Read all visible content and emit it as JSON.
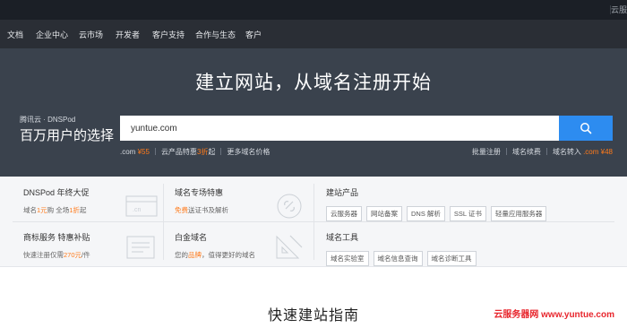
{
  "topbar": {
    "cloud_link": "云服"
  },
  "nav": {
    "items": [
      "文档",
      "企业中心",
      "云市场",
      "开发者",
      "客户支持",
      "合作与生态",
      "客户"
    ]
  },
  "hero": {
    "headline": "建立网站，从域名注册开始",
    "brand_small": "腾讯云 · DNSPod",
    "brand_big": "百万用户的选择",
    "search_value": "yuntue.com",
    "promo_left": {
      "com_label": ".com",
      "com_price": "¥55",
      "cloud_label": "云产品特惠",
      "cloud_discount": "3折",
      "cloud_suffix": "起",
      "more": "更多域名价格"
    },
    "promo_right": {
      "bulk": "批量注册",
      "renew": "域名续费",
      "transfer": "域名转入",
      "transfer_com": ".com",
      "transfer_price": "¥48"
    }
  },
  "offers": {
    "c1": {
      "title": "DNSPod 年终大促",
      "sub_a": "域名",
      "sub_b": "1元",
      "sub_c": "购 全场",
      "sub_d": "1折",
      "sub_e": "起"
    },
    "c2": {
      "title": "域名专场特惠",
      "sub_a": "免费",
      "sub_b": "送证书及解析"
    },
    "c3": {
      "title": "建站产品",
      "tags": [
        "云服务器",
        "网站备案",
        "DNS 解析",
        "SSL 证书",
        "轻量应用服务器"
      ]
    },
    "c4": {
      "title": "商标服务 特惠补贴",
      "sub_a": "快速注册仅需",
      "sub_b": "270元",
      "sub_c": "/件"
    },
    "c5": {
      "title": "白金域名",
      "sub_a": "您的",
      "sub_b": "品牌",
      "sub_c": "，值得更好的域名"
    },
    "c6": {
      "title": "域名工具",
      "tags": [
        "域名实验室",
        "域名信息查询",
        "域名诊断工具"
      ]
    }
  },
  "guide_title": "快速建站指南",
  "watermark": "云服务器网 www.yuntue.com",
  "colors": {
    "accent_blue": "#2d8cf0",
    "accent_orange": "#ff7a1a",
    "hero_bg": "#3a424d"
  }
}
